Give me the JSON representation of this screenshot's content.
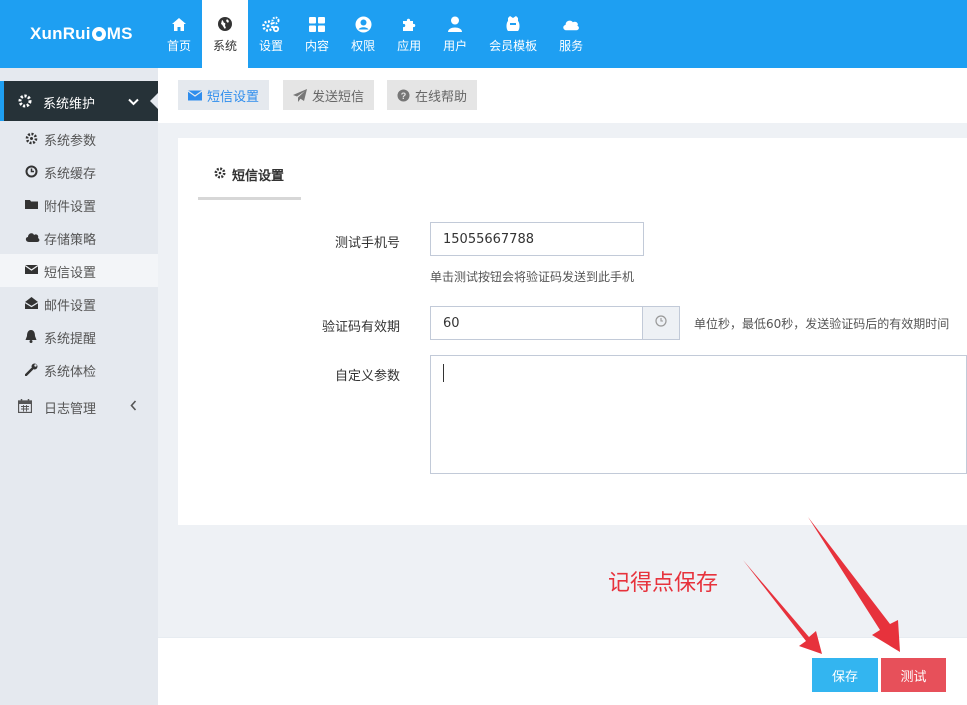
{
  "brand": {
    "name": "XunRuiCMS",
    "prefix": "XunRui",
    "suffix": "MS"
  },
  "top_nav": [
    {
      "label": "首页",
      "icon": "home-icon"
    },
    {
      "label": "系统",
      "icon": "globe-icon",
      "active": true
    },
    {
      "label": "设置",
      "icon": "cogs-icon"
    },
    {
      "label": "内容",
      "icon": "grid-icon"
    },
    {
      "label": "权限",
      "icon": "user-circle-icon"
    },
    {
      "label": "应用",
      "icon": "puzzle-icon"
    },
    {
      "label": "用户",
      "icon": "user-icon"
    },
    {
      "label": "会员模板",
      "icon": "template-icon"
    },
    {
      "label": "服务",
      "icon": "cloud-icon"
    }
  ],
  "sidebar": {
    "group": {
      "label": "系统维护",
      "icon": "gear-icon"
    },
    "items": [
      {
        "label": "系统参数",
        "icon": "cog-icon"
      },
      {
        "label": "系统缓存",
        "icon": "clock-icon"
      },
      {
        "label": "附件设置",
        "icon": "folder-icon"
      },
      {
        "label": "存储策略",
        "icon": "cloud-icon"
      },
      {
        "label": "短信设置",
        "icon": "envelope-icon",
        "active": true
      },
      {
        "label": "邮件设置",
        "icon": "envelope-open-icon"
      },
      {
        "label": "系统提醒",
        "icon": "bell-icon"
      },
      {
        "label": "系统体检",
        "icon": "wrench-icon"
      }
    ],
    "log": {
      "label": "日志管理",
      "icon": "calendar-icon"
    }
  },
  "toolbar": {
    "sms_settings": "短信设置",
    "send_sms": "发送短信",
    "online_help": "在线帮助"
  },
  "panel": {
    "tab": "短信设置",
    "phone": {
      "label": "测试手机号",
      "value": "15055667788",
      "help": "单击测试按钮会将验证码发送到此手机"
    },
    "expire": {
      "label": "验证码有效期",
      "value": "60",
      "help": "单位秒，最低60秒，发送验证码后的有效期时间"
    },
    "params": {
      "label": "自定义参数",
      "value": ""
    }
  },
  "buttons": {
    "save": "保存",
    "test": "测试"
  },
  "annotation": "记得点保存",
  "colors": {
    "primary": "#1e9ff2",
    "sidebar_dark": "#263238",
    "save": "#33b5f0",
    "test": "#e7505a",
    "annotation": "#e7323c"
  }
}
